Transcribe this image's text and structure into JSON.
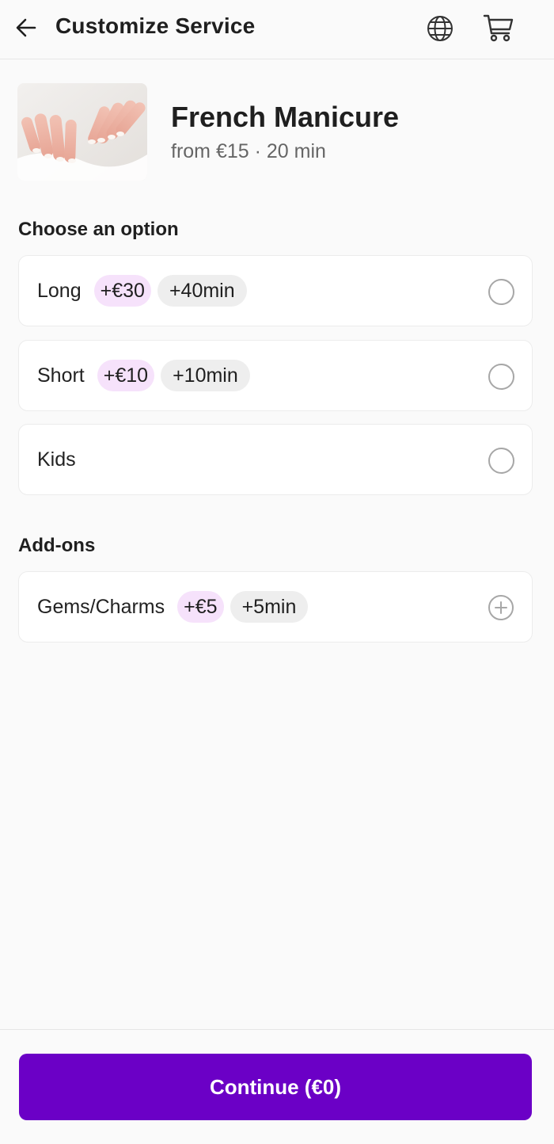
{
  "header": {
    "title": "Customize Service",
    "icons": [
      "back-arrow-icon",
      "globe-icon",
      "cart-icon"
    ]
  },
  "service": {
    "name": "French Manicure",
    "meta": "from €15 · 20 min",
    "image": "french-manicure-photo"
  },
  "options": {
    "title": "Choose an option",
    "items": [
      {
        "label": "Long",
        "price": "+€30",
        "time": "+40min"
      },
      {
        "label": "Short",
        "price": "+€10",
        "time": "+10min"
      },
      {
        "label": "Kids"
      }
    ]
  },
  "addons": {
    "title": "Add-ons",
    "items": [
      {
        "label": "Gems/Charms",
        "price": "+€5",
        "time": "+5min"
      }
    ]
  },
  "footer": {
    "continue_label": "Continue (€0)"
  },
  "colors": {
    "accent": "#6b00c6",
    "price_pill": "#f6e2fb",
    "time_pill": "#eeeeee"
  }
}
